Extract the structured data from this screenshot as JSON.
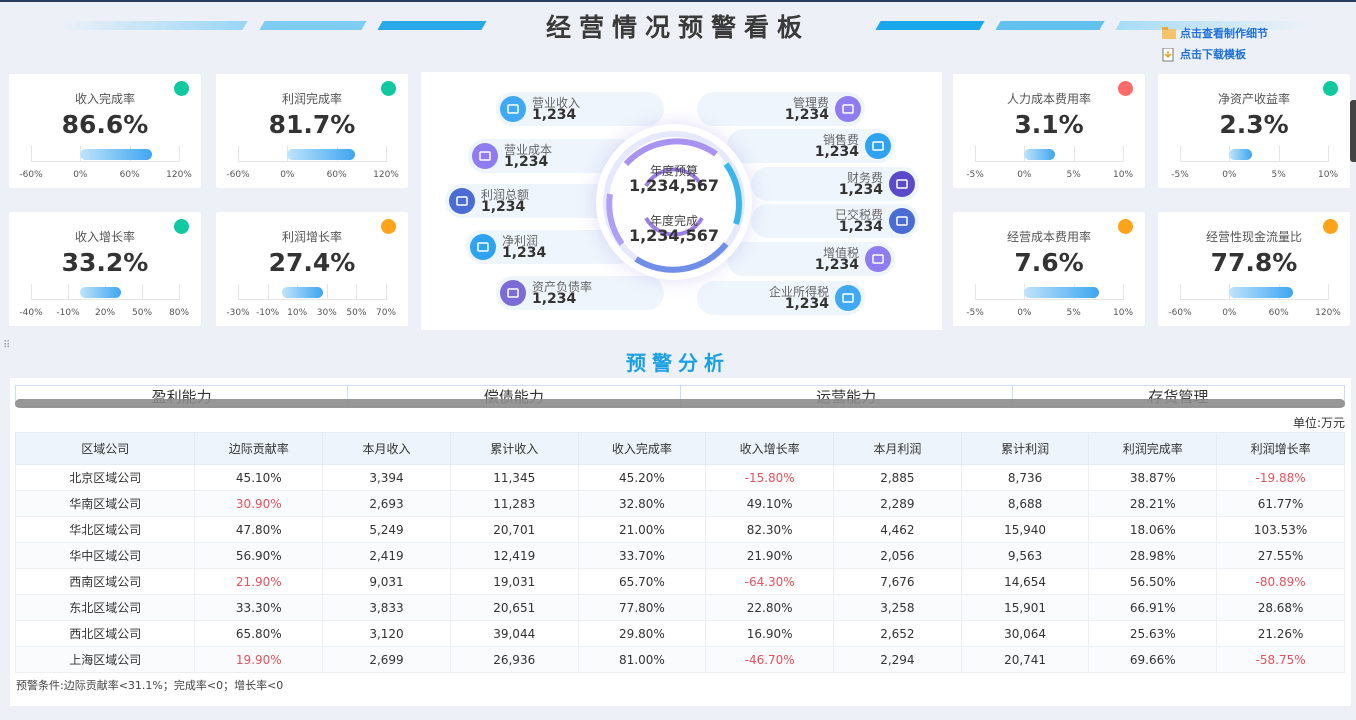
{
  "header": {
    "title": "经营情况预警看板",
    "links": [
      {
        "label": "点击查看制作细节",
        "icon": "folder-icon"
      },
      {
        "label": "点击下载模板",
        "icon": "download-file-icon"
      }
    ]
  },
  "kpis": [
    {
      "label": "收入完成率",
      "value": "86.6%",
      "status": "#10c9a0",
      "fill": 0.866,
      "ticks": [
        "-60%",
        "0%",
        "60%",
        "120%"
      ]
    },
    {
      "label": "利润完成率",
      "value": "81.7%",
      "status": "#10c9a0",
      "fill": 0.817,
      "ticks": [
        "-60%",
        "0%",
        "60%",
        "120%"
      ]
    },
    {
      "label": "人力成本费用率",
      "value": "3.1%",
      "status": "#ff6b6b",
      "fill": 0.031,
      "ticks": [
        "-5%",
        "0%",
        "5%",
        "10%"
      ]
    },
    {
      "label": "净资产收益率",
      "value": "2.3%",
      "status": "#10c9a0",
      "fill": 0.023,
      "ticks": [
        "-5%",
        "0%",
        "5%",
        "10%"
      ]
    },
    {
      "label": "收入增长率",
      "value": "33.2%",
      "status": "#10c9a0",
      "fill": 0.332,
      "ticks": [
        "-40%",
        "-10%",
        "20%",
        "50%",
        "80%"
      ]
    },
    {
      "label": "利润增长率",
      "value": "27.4%",
      "status": "#ffa31a",
      "fill": 0.274,
      "ticks": [
        "-30%",
        "-10%",
        "10%",
        "30%",
        "50%",
        "70%"
      ]
    },
    {
      "label": "经营成本费用率",
      "value": "7.6%",
      "status": "#ffa31a",
      "fill": 0.076,
      "ticks": [
        "-5%",
        "0%",
        "5%",
        "10%"
      ]
    },
    {
      "label": "经营性现金流量比",
      "value": "77.8%",
      "status": "#ffa31a",
      "fill": 0.778,
      "ticks": [
        "-60%",
        "0%",
        "60%",
        "120%"
      ]
    }
  ],
  "center": {
    "budget_label": "年度预算",
    "budget_value": "1,234,567",
    "done_label": "年度完成",
    "done_value": "1,234,567",
    "left": [
      {
        "name": "营业收入",
        "value": "1,234",
        "icon": "money-bag-icon",
        "color": "#3fa9f5"
      },
      {
        "name": "营业成本",
        "value": "1,234",
        "icon": "cost-icon",
        "color": "#8e7cf0"
      },
      {
        "name": "利润总额",
        "value": "1,234",
        "icon": "profit-icon",
        "color": "#4a6cd4"
      },
      {
        "name": "净利润",
        "value": "1,234",
        "icon": "net-profit-icon",
        "color": "#2ea3f2"
      },
      {
        "name": "资产负债率",
        "value": "1,234",
        "icon": "ratio-icon",
        "color": "#7b6bd6"
      }
    ],
    "right": [
      {
        "name": "管理费",
        "value": "1,234",
        "icon": "management-icon",
        "color": "#8e7cf0"
      },
      {
        "name": "销售费",
        "value": "1,234",
        "icon": "bar-chart-icon",
        "color": "#2ea3f2"
      },
      {
        "name": "财务费",
        "value": "1,234",
        "icon": "safe-icon",
        "color": "#5a49c8"
      },
      {
        "name": "已交税费",
        "value": "1,234",
        "icon": "tax-icon",
        "color": "#4a6cd4"
      },
      {
        "name": "增值税",
        "value": "1,234",
        "icon": "coins-icon",
        "color": "#8e7cf0"
      },
      {
        "name": "企业所得税",
        "value": "1,234",
        "icon": "chart-icon",
        "color": "#3fa9f5"
      }
    ]
  },
  "analysis": {
    "title": "预警分析",
    "tabs": [
      "盈利能力",
      "偿债能力",
      "运营能力",
      "存货管理"
    ],
    "unit": "单位:万元",
    "columns": [
      "区域公司",
      "边际贡献率",
      "本月收入",
      "累计收入",
      "收入完成率",
      "收入增长率",
      "本月利润",
      "累计利润",
      "利润完成率",
      "利润增长率"
    ],
    "rows": [
      [
        "北京区域公司",
        "45.10%",
        "3,394",
        "11,345",
        "45.20%",
        "-15.80%",
        "2,885",
        "8,736",
        "38.87%",
        "-19.88%"
      ],
      [
        "华南区域公司",
        "30.90%",
        "2,693",
        "11,283",
        "32.80%",
        "49.10%",
        "2,289",
        "8,688",
        "28.21%",
        "61.77%"
      ],
      [
        "华北区域公司",
        "47.80%",
        "5,249",
        "20,701",
        "21.00%",
        "82.30%",
        "4,462",
        "15,940",
        "18.06%",
        "103.53%"
      ],
      [
        "华中区域公司",
        "56.90%",
        "2,419",
        "12,419",
        "33.70%",
        "21.90%",
        "2,056",
        "9,563",
        "28.98%",
        "27.55%"
      ],
      [
        "西南区域公司",
        "21.90%",
        "9,031",
        "19,031",
        "65.70%",
        "-64.30%",
        "7,676",
        "14,654",
        "56.50%",
        "-80.89%"
      ],
      [
        "东北区域公司",
        "33.30%",
        "3,833",
        "20,651",
        "77.80%",
        "22.80%",
        "3,258",
        "15,901",
        "66.91%",
        "28.68%"
      ],
      [
        "西北区域公司",
        "65.80%",
        "3,120",
        "39,044",
        "29.80%",
        "16.90%",
        "2,652",
        "30,064",
        "25.63%",
        "21.26%"
      ],
      [
        "上海区域公司",
        "19.90%",
        "2,699",
        "26,936",
        "81.00%",
        "-46.70%",
        "2,294",
        "20,741",
        "69.66%",
        "-58.75%"
      ]
    ],
    "condition": "预警条件:边际贡献率<31.1%；完成率<0；增长率<0"
  }
}
